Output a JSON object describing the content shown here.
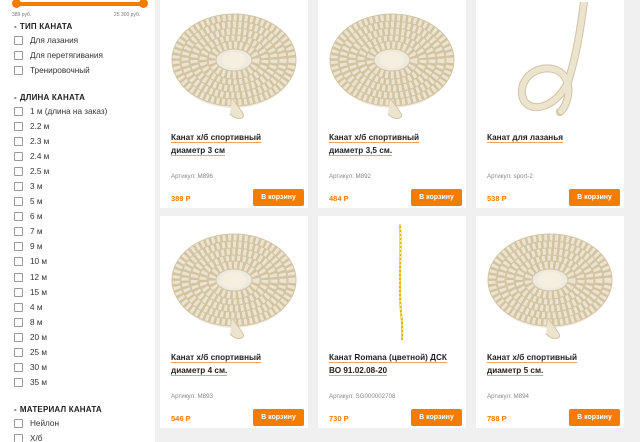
{
  "price_filter": {
    "min_label": "389 руб.",
    "max_label": "25 300 руб."
  },
  "filters": [
    {
      "title": "ТИП КАНАТА",
      "items": [
        "Для лазания",
        "Для перетягивания",
        "Тренировочный"
      ]
    },
    {
      "title": "ДЛИНА КАНАТА",
      "items": [
        "1 м (длина на заказ)",
        "2.2 м",
        "2.3 м",
        "2.4 м",
        "2.5 м",
        "3 м",
        "5 м",
        "6 м",
        "7 м",
        "9 м",
        "10 м",
        "12 м",
        "15 м",
        "4 м",
        "8 м",
        "20 м",
        "25 м",
        "30 м",
        "35 м"
      ]
    },
    {
      "title": "МАТЕРИАЛ КАНАТА",
      "items": [
        "Нейлон",
        "Х/б"
      ]
    }
  ],
  "products": [
    {
      "title_lines": [
        "Канат х/б спортивный",
        "диаметр 3 см"
      ],
      "sku": "Артикул: М896",
      "price": "389 Р",
      "button": "В корзину",
      "image": "coiled-rope-icon"
    },
    {
      "title_lines": [
        "Канат х/б спортивный",
        "диаметр 3,5 см."
      ],
      "sku": "Артикул: М892",
      "price": "484 Р",
      "button": "В корзину",
      "image": "coiled-rope-icon"
    },
    {
      "title_lines": [
        "Канат для лазанья",
        ""
      ],
      "sku": "Артикул: sport-2",
      "price": "538 Р",
      "button": "В корзину",
      "image": "hanging-rope-icon"
    },
    {
      "title_lines": [
        "Канат х/б спортивный",
        "диаметр 4 см."
      ],
      "sku": "Артикул: М893",
      "price": "546 Р",
      "button": "В корзину",
      "image": "coiled-rope-icon"
    },
    {
      "title_lines": [
        "Канат Romana (цветной) ДСК",
        "ВО 91.02.08-20"
      ],
      "sku": "Артикул: SG000002708",
      "price": "730 Р",
      "button": "В корзину",
      "image": "thin-rope-icon"
    },
    {
      "title_lines": [
        "Канат х/б спортивный",
        "диаметр 5 см."
      ],
      "sku": "Артикул: М894",
      "price": "788 Р",
      "button": "В корзину",
      "image": "coiled-rope-icon"
    }
  ],
  "colors": {
    "accent": "#f57c00",
    "rope": "#ede4cf",
    "rope_shadow": "#d2c4a3"
  }
}
